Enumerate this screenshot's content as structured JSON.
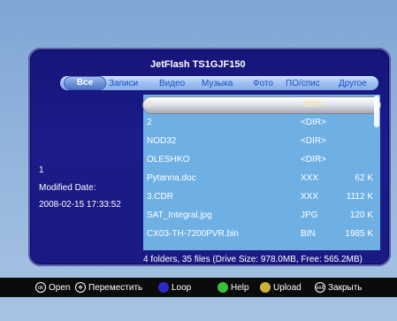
{
  "title": "JetFlash TS1GJF150",
  "tabs": [
    {
      "label": "Все"
    },
    {
      "label": "Записи"
    },
    {
      "label": "Видео"
    },
    {
      "label": "Музыка"
    },
    {
      "label": "Фото"
    },
    {
      "label": "ПО/спис"
    },
    {
      "label": "Другое"
    }
  ],
  "files": [
    {
      "name": "1",
      "type": "<DIR>",
      "size": ""
    },
    {
      "name": "2",
      "type": "<DIR>",
      "size": ""
    },
    {
      "name": "NOD32",
      "type": "<DIR>",
      "size": ""
    },
    {
      "name": "OLESHKO",
      "type": "<DIR>",
      "size": ""
    },
    {
      "name": "Pytanna.doc",
      "type": "XXX",
      "size": "62 K"
    },
    {
      "name": "3.CDR",
      "type": "XXX",
      "size": "1112 K"
    },
    {
      "name": "SAT_Integral.jpg",
      "type": "JPG",
      "size": "120 K"
    },
    {
      "name": "CX03-TH-7200PVR.bin",
      "type": "BIN",
      "size": "1985 K"
    }
  ],
  "info": {
    "selected": "1",
    "modified_label": "Modified Date:",
    "modified_value": "2008-02-15 17:33:52"
  },
  "status": "4 folders, 35 files (Drive Size: 978.0MB, Free: 565.2MB)",
  "hints": [
    {
      "icon": "ok",
      "label": "Open"
    },
    {
      "icon": "arrows",
      "label": "Переместить"
    },
    {
      "icon": "blue",
      "label": "Loop"
    },
    {
      "icon": "green",
      "label": "Help"
    },
    {
      "icon": "yellow",
      "label": "Upload"
    },
    {
      "icon": "exit",
      "label": "Закрыть"
    }
  ],
  "colors": {
    "blue": "#2a2ac8",
    "green": "#39c039",
    "yellow": "#cdb23a"
  }
}
